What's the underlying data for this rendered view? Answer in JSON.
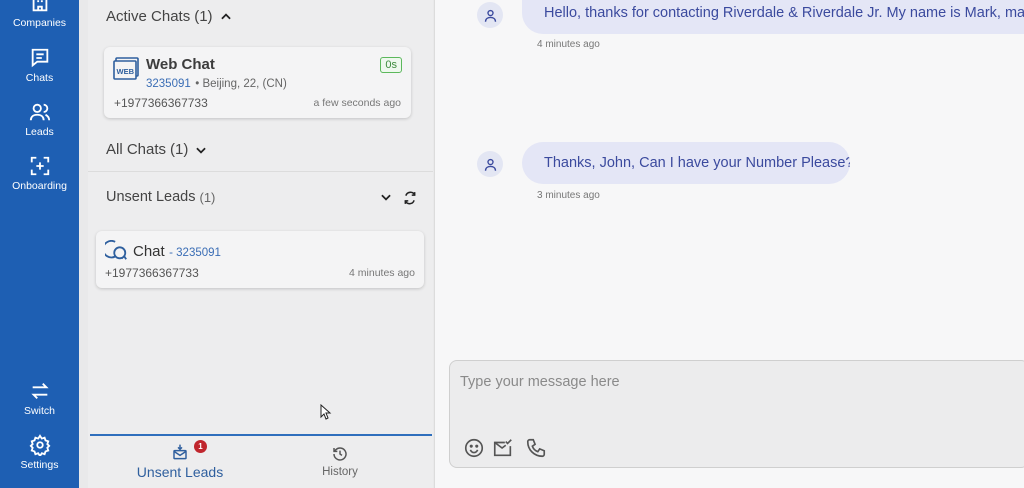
{
  "nav": {
    "companies": "Companies",
    "chats": "Chats",
    "leads": "Leads",
    "onboarding": "Onboarding",
    "switch": "Switch",
    "settings": "Settings"
  },
  "active_chats": {
    "label": "Active Chats",
    "count": "(1)",
    "card": {
      "title": "Web Chat",
      "id": "3235091",
      "location": "• Beijing, 22, (CN)",
      "timer": "0s",
      "phone": "+1977366367733",
      "time": "a few seconds ago"
    }
  },
  "all_chats": {
    "label": "All Chats",
    "count": "(1)"
  },
  "unsent_leads": {
    "label": "Unsent Leads",
    "count": "(1)",
    "card": {
      "title": "Chat",
      "id": "- 3235091",
      "phone": "+1977366367733",
      "time": "4 minutes ago"
    }
  },
  "tabs": {
    "unsent_leads": "Unsent Leads",
    "badge": "1",
    "history": "History"
  },
  "messages": [
    {
      "text": "Hello, thanks for contacting Riverdale & Riverdale Jr. My name is Mark, may I h",
      "time": "4 minutes ago"
    },
    {
      "text": "Thanks, John, Can I have your Number Please?",
      "time": "3 minutes ago"
    }
  ],
  "composer": {
    "placeholder": "Type your message here"
  },
  "colors": {
    "rail": "#1e5fb3",
    "bubble": "#e4e6f6",
    "bubble_text": "#3b4a9e",
    "badge": "#c0262d",
    "timer": "#5cb85c"
  }
}
